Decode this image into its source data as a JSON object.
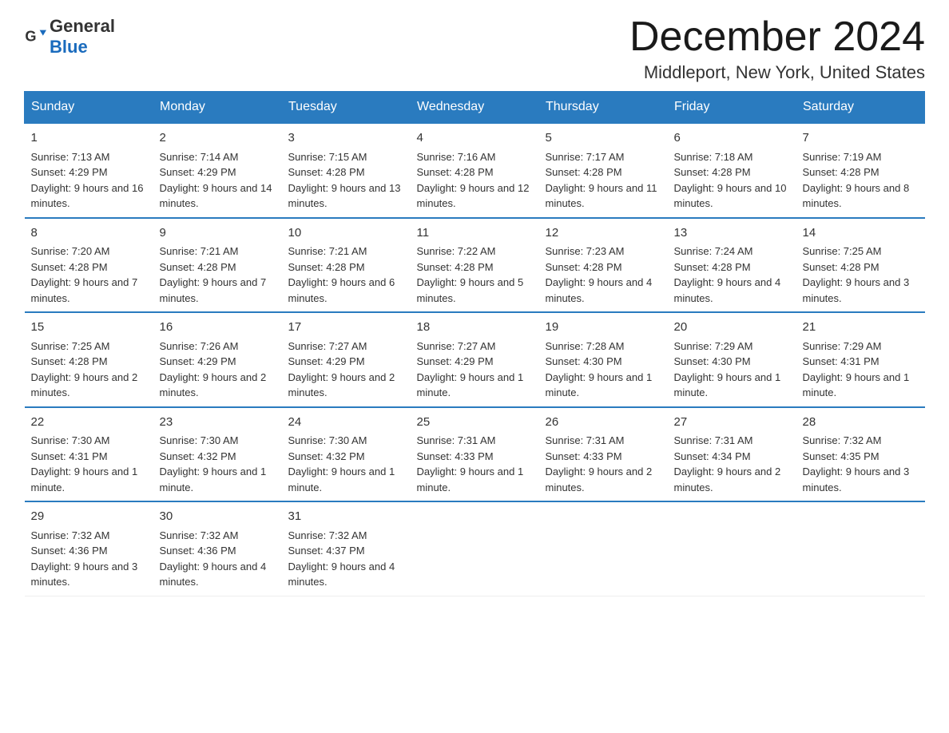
{
  "logo": {
    "text_general": "General",
    "text_blue": "Blue"
  },
  "header": {
    "month_year": "December 2024",
    "location": "Middleport, New York, United States"
  },
  "days_of_week": [
    "Sunday",
    "Monday",
    "Tuesday",
    "Wednesday",
    "Thursday",
    "Friday",
    "Saturday"
  ],
  "weeks": [
    [
      {
        "day": "1",
        "sunrise": "Sunrise: 7:13 AM",
        "sunset": "Sunset: 4:29 PM",
        "daylight": "Daylight: 9 hours and 16 minutes."
      },
      {
        "day": "2",
        "sunrise": "Sunrise: 7:14 AM",
        "sunset": "Sunset: 4:29 PM",
        "daylight": "Daylight: 9 hours and 14 minutes."
      },
      {
        "day": "3",
        "sunrise": "Sunrise: 7:15 AM",
        "sunset": "Sunset: 4:28 PM",
        "daylight": "Daylight: 9 hours and 13 minutes."
      },
      {
        "day": "4",
        "sunrise": "Sunrise: 7:16 AM",
        "sunset": "Sunset: 4:28 PM",
        "daylight": "Daylight: 9 hours and 12 minutes."
      },
      {
        "day": "5",
        "sunrise": "Sunrise: 7:17 AM",
        "sunset": "Sunset: 4:28 PM",
        "daylight": "Daylight: 9 hours and 11 minutes."
      },
      {
        "day": "6",
        "sunrise": "Sunrise: 7:18 AM",
        "sunset": "Sunset: 4:28 PM",
        "daylight": "Daylight: 9 hours and 10 minutes."
      },
      {
        "day": "7",
        "sunrise": "Sunrise: 7:19 AM",
        "sunset": "Sunset: 4:28 PM",
        "daylight": "Daylight: 9 hours and 8 minutes."
      }
    ],
    [
      {
        "day": "8",
        "sunrise": "Sunrise: 7:20 AM",
        "sunset": "Sunset: 4:28 PM",
        "daylight": "Daylight: 9 hours and 7 minutes."
      },
      {
        "day": "9",
        "sunrise": "Sunrise: 7:21 AM",
        "sunset": "Sunset: 4:28 PM",
        "daylight": "Daylight: 9 hours and 7 minutes."
      },
      {
        "day": "10",
        "sunrise": "Sunrise: 7:21 AM",
        "sunset": "Sunset: 4:28 PM",
        "daylight": "Daylight: 9 hours and 6 minutes."
      },
      {
        "day": "11",
        "sunrise": "Sunrise: 7:22 AM",
        "sunset": "Sunset: 4:28 PM",
        "daylight": "Daylight: 9 hours and 5 minutes."
      },
      {
        "day": "12",
        "sunrise": "Sunrise: 7:23 AM",
        "sunset": "Sunset: 4:28 PM",
        "daylight": "Daylight: 9 hours and 4 minutes."
      },
      {
        "day": "13",
        "sunrise": "Sunrise: 7:24 AM",
        "sunset": "Sunset: 4:28 PM",
        "daylight": "Daylight: 9 hours and 4 minutes."
      },
      {
        "day": "14",
        "sunrise": "Sunrise: 7:25 AM",
        "sunset": "Sunset: 4:28 PM",
        "daylight": "Daylight: 9 hours and 3 minutes."
      }
    ],
    [
      {
        "day": "15",
        "sunrise": "Sunrise: 7:25 AM",
        "sunset": "Sunset: 4:28 PM",
        "daylight": "Daylight: 9 hours and 2 minutes."
      },
      {
        "day": "16",
        "sunrise": "Sunrise: 7:26 AM",
        "sunset": "Sunset: 4:29 PM",
        "daylight": "Daylight: 9 hours and 2 minutes."
      },
      {
        "day": "17",
        "sunrise": "Sunrise: 7:27 AM",
        "sunset": "Sunset: 4:29 PM",
        "daylight": "Daylight: 9 hours and 2 minutes."
      },
      {
        "day": "18",
        "sunrise": "Sunrise: 7:27 AM",
        "sunset": "Sunset: 4:29 PM",
        "daylight": "Daylight: 9 hours and 1 minute."
      },
      {
        "day": "19",
        "sunrise": "Sunrise: 7:28 AM",
        "sunset": "Sunset: 4:30 PM",
        "daylight": "Daylight: 9 hours and 1 minute."
      },
      {
        "day": "20",
        "sunrise": "Sunrise: 7:29 AM",
        "sunset": "Sunset: 4:30 PM",
        "daylight": "Daylight: 9 hours and 1 minute."
      },
      {
        "day": "21",
        "sunrise": "Sunrise: 7:29 AM",
        "sunset": "Sunset: 4:31 PM",
        "daylight": "Daylight: 9 hours and 1 minute."
      }
    ],
    [
      {
        "day": "22",
        "sunrise": "Sunrise: 7:30 AM",
        "sunset": "Sunset: 4:31 PM",
        "daylight": "Daylight: 9 hours and 1 minute."
      },
      {
        "day": "23",
        "sunrise": "Sunrise: 7:30 AM",
        "sunset": "Sunset: 4:32 PM",
        "daylight": "Daylight: 9 hours and 1 minute."
      },
      {
        "day": "24",
        "sunrise": "Sunrise: 7:30 AM",
        "sunset": "Sunset: 4:32 PM",
        "daylight": "Daylight: 9 hours and 1 minute."
      },
      {
        "day": "25",
        "sunrise": "Sunrise: 7:31 AM",
        "sunset": "Sunset: 4:33 PM",
        "daylight": "Daylight: 9 hours and 1 minute."
      },
      {
        "day": "26",
        "sunrise": "Sunrise: 7:31 AM",
        "sunset": "Sunset: 4:33 PM",
        "daylight": "Daylight: 9 hours and 2 minutes."
      },
      {
        "day": "27",
        "sunrise": "Sunrise: 7:31 AM",
        "sunset": "Sunset: 4:34 PM",
        "daylight": "Daylight: 9 hours and 2 minutes."
      },
      {
        "day": "28",
        "sunrise": "Sunrise: 7:32 AM",
        "sunset": "Sunset: 4:35 PM",
        "daylight": "Daylight: 9 hours and 3 minutes."
      }
    ],
    [
      {
        "day": "29",
        "sunrise": "Sunrise: 7:32 AM",
        "sunset": "Sunset: 4:36 PM",
        "daylight": "Daylight: 9 hours and 3 minutes."
      },
      {
        "day": "30",
        "sunrise": "Sunrise: 7:32 AM",
        "sunset": "Sunset: 4:36 PM",
        "daylight": "Daylight: 9 hours and 4 minutes."
      },
      {
        "day": "31",
        "sunrise": "Sunrise: 7:32 AM",
        "sunset": "Sunset: 4:37 PM",
        "daylight": "Daylight: 9 hours and 4 minutes."
      },
      null,
      null,
      null,
      null
    ]
  ]
}
